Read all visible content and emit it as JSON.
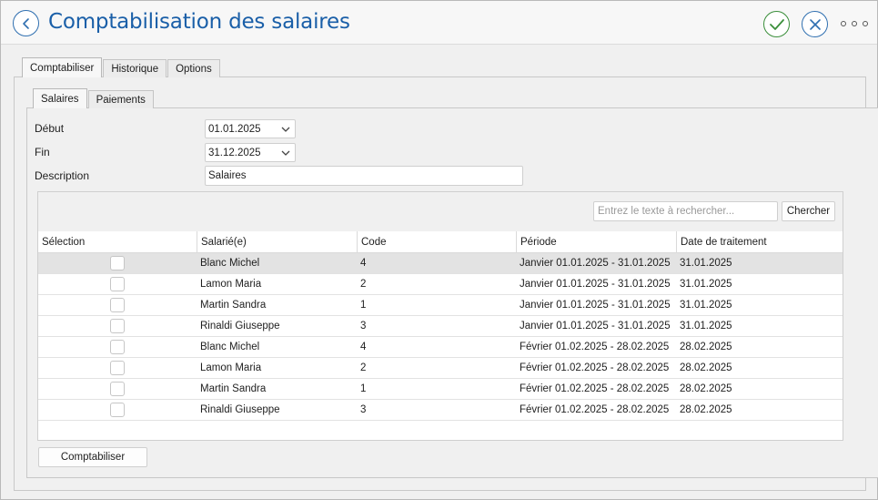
{
  "window": {
    "title": "Comptabilisation des salaires",
    "accent": "#1a5fa8",
    "ok_color": "#3b8f3b"
  },
  "icons": {
    "back": "chevron-left-icon",
    "ok": "checkmark-icon",
    "cancel": "close-icon",
    "more": "more-icon"
  },
  "tabs": [
    {
      "label": "Comptabiliser",
      "active": true
    },
    {
      "label": "Historique",
      "active": false
    },
    {
      "label": "Options",
      "active": false
    }
  ],
  "subtabs": [
    {
      "label": "Salaires",
      "active": true
    },
    {
      "label": "Paiements",
      "active": false
    }
  ],
  "form": {
    "start_label": "Début",
    "start_value": "01.01.2025",
    "end_label": "Fin",
    "end_value": "31.12.2025",
    "description_label": "Description",
    "description_value": "Salaires"
  },
  "search": {
    "placeholder": "Entrez le texte à rechercher...",
    "button": "Chercher"
  },
  "table": {
    "columns": [
      "Sélection",
      "Salarié(e)",
      "Code",
      "Période",
      "Date de traitement"
    ],
    "rows": [
      {
        "checked": false,
        "employee": "Blanc Michel",
        "code": "4",
        "period": "Janvier 01.01.2025 - 31.01.2025",
        "date": "31.01.2025",
        "selected": true
      },
      {
        "checked": false,
        "employee": "Lamon Maria",
        "code": "2",
        "period": "Janvier 01.01.2025 - 31.01.2025",
        "date": "31.01.2025"
      },
      {
        "checked": false,
        "employee": "Martin Sandra",
        "code": "1",
        "period": "Janvier 01.01.2025 - 31.01.2025",
        "date": "31.01.2025"
      },
      {
        "checked": false,
        "employee": "Rinaldi Giuseppe",
        "code": "3",
        "period": "Janvier 01.01.2025 - 31.01.2025",
        "date": "31.01.2025"
      },
      {
        "checked": false,
        "employee": "Blanc Michel",
        "code": "4",
        "period": "Février 01.02.2025 - 28.02.2025",
        "date": "28.02.2025"
      },
      {
        "checked": false,
        "employee": "Lamon Maria",
        "code": "2",
        "period": "Février 01.02.2025 - 28.02.2025",
        "date": "28.02.2025"
      },
      {
        "checked": false,
        "employee": "Martin Sandra",
        "code": "1",
        "period": "Février 01.02.2025 - 28.02.2025",
        "date": "28.02.2025"
      },
      {
        "checked": false,
        "employee": "Rinaldi Giuseppe",
        "code": "3",
        "period": "Février 01.02.2025 - 28.02.2025",
        "date": "28.02.2025"
      }
    ]
  },
  "actions": {
    "post_button": "Comptabiliser"
  }
}
